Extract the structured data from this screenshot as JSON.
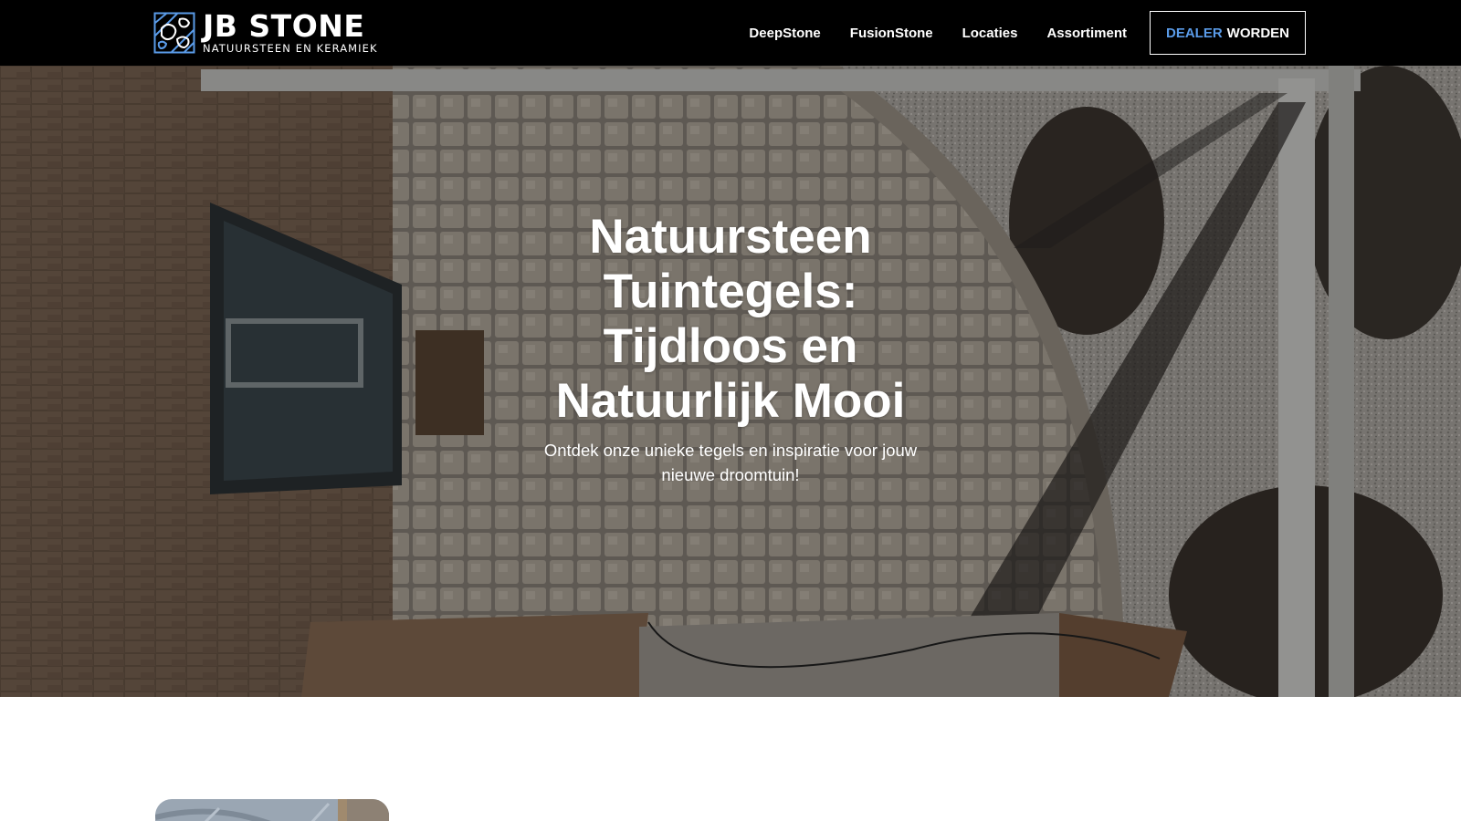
{
  "header": {
    "logo": {
      "name": "JB STONE",
      "tagline": "NATUURSTEEN EN KERAMIEK"
    },
    "nav": [
      {
        "label": "DeepStone"
      },
      {
        "label": "FusionStone"
      },
      {
        "label": "Locaties"
      },
      {
        "label": "Assortiment"
      }
    ],
    "cta": {
      "accent": "DEALER",
      "label": "WORDEN"
    }
  },
  "hero": {
    "title": "Natuursteen Tuintegels: Tijdloos en Natuurlijk Mooi",
    "subtitle": "Ontdek onze unieke tegels en inspiratie voor jouw nieuwe droomtuin!"
  },
  "colors": {
    "header_bg": "#000000",
    "accent": "#5a9be8",
    "text_light": "#ffffff"
  }
}
